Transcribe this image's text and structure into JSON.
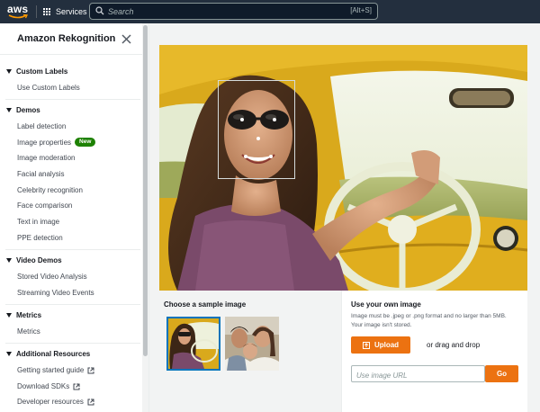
{
  "topbar": {
    "logo_text": "aws",
    "services_label": "Services",
    "search_placeholder": "Search",
    "search_shortcut": "[Alt+S]"
  },
  "sidebar": {
    "title": "Amazon Rekognition",
    "sections": [
      {
        "label": "Custom Labels",
        "items": [
          {
            "label": "Use Custom Labels"
          }
        ]
      },
      {
        "label": "Demos",
        "items": [
          {
            "label": "Label detection"
          },
          {
            "label": "Image properties",
            "badge": "New"
          },
          {
            "label": "Image moderation"
          },
          {
            "label": "Facial analysis"
          },
          {
            "label": "Celebrity recognition"
          },
          {
            "label": "Face comparison"
          },
          {
            "label": "Text in image"
          },
          {
            "label": "PPE detection"
          }
        ]
      },
      {
        "label": "Video Demos",
        "items": [
          {
            "label": "Stored Video Analysis"
          },
          {
            "label": "Streaming Video Events"
          }
        ]
      },
      {
        "label": "Metrics",
        "items": [
          {
            "label": "Metrics"
          }
        ]
      },
      {
        "label": "Additional Resources",
        "items": [
          {
            "label": "Getting started guide",
            "external": true
          },
          {
            "label": "Download SDKs",
            "external": true
          },
          {
            "label": "Developer resources",
            "external": true
          }
        ]
      }
    ]
  },
  "main": {
    "choose_sample_title": "Choose a sample image",
    "own_image_title": "Use your own image",
    "own_image_desc": "Image must be .jpeg or .png format and no larger than 5MB. Your image isn't stored.",
    "upload_label": "Upload",
    "drag_label": "or drag and drop",
    "url_placeholder": "Use image URL",
    "go_label": "Go"
  },
  "colors": {
    "topbar": "#232f3e",
    "accent_orange": "#ec7211",
    "badge_green": "#1d8102",
    "selection_blue": "#0073bb"
  },
  "icons": {
    "close": "close-icon",
    "search": "search-icon",
    "services": "grid-icon",
    "upload": "upload-icon",
    "external": "external-link-icon",
    "caret": "caret-down-icon"
  }
}
